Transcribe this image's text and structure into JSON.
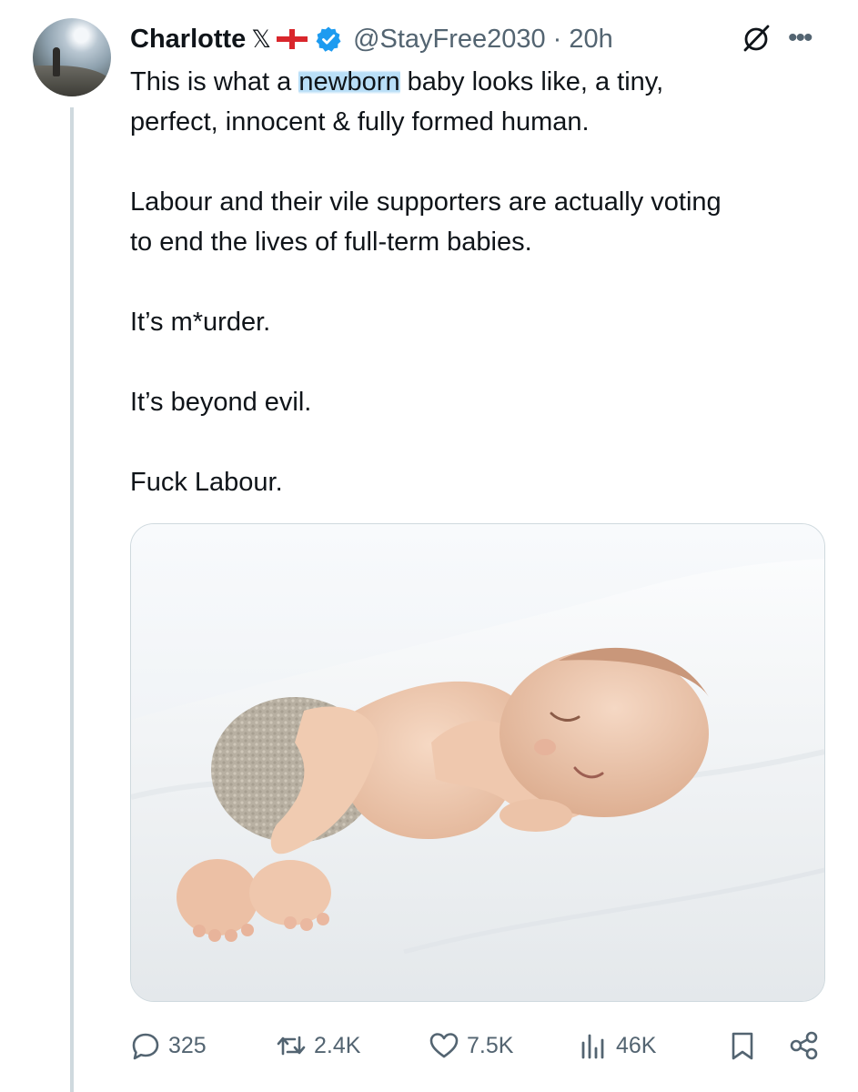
{
  "post": {
    "author_name": "Charlotte",
    "x_badge": "𝕏",
    "handle": "@StayFree2030",
    "separator": "·",
    "time_ago": "20h",
    "text": {
      "line1_before": "This is what a ",
      "line1_highlight": "newborn",
      "line1_after": " baby looks like, a tiny,",
      "line2": "perfect, innocent & fully formed human.",
      "paragraph2_line1": "Labour and their vile supporters are actually voting",
      "paragraph2_line2": "to end the lives of full-term babies.",
      "paragraph3": "It’s m*urder.",
      "paragraph4": "It’s beyond evil.",
      "paragraph5": "Fuck Labour."
    },
    "media": {
      "icon": "newborn-baby-photo"
    },
    "metrics": {
      "replies": "325",
      "reposts": "2.4K",
      "likes": "7.5K",
      "views": "46K"
    }
  },
  "colors": {
    "text": "#0f1419",
    "secondary": "#536471",
    "verified": "#1d9bf0",
    "flag_red": "#d9262c",
    "highlight": "#80c4f0",
    "thread_line": "#cfd9de"
  },
  "icons": {
    "verified": "verified-badge-icon",
    "grok": "grok-icon",
    "more": "more-options-icon",
    "reply": "reply-icon",
    "repost": "repost-icon",
    "like": "like-icon",
    "views": "views-icon",
    "bookmark": "bookmark-icon",
    "share": "share-icon"
  }
}
